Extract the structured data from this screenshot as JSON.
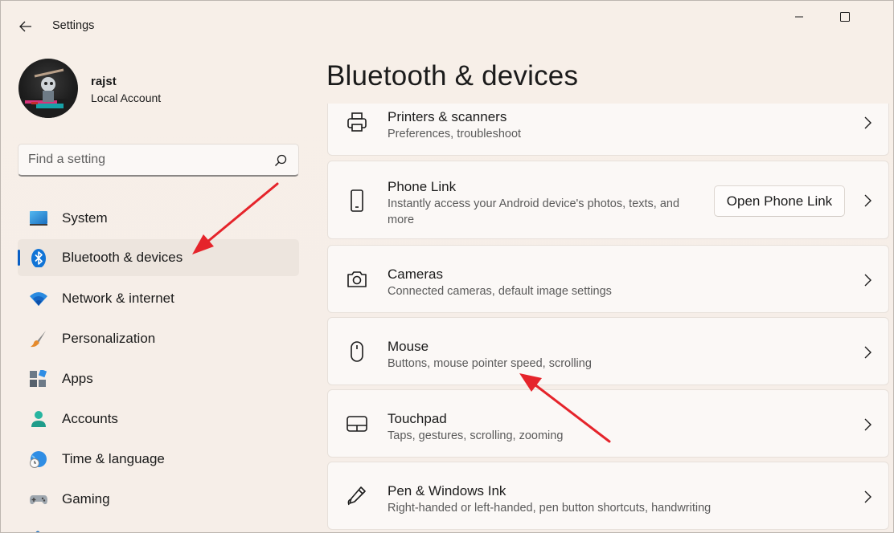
{
  "app": {
    "title": "Settings"
  },
  "profile": {
    "name": "rajst",
    "account_type": "Local Account"
  },
  "search": {
    "placeholder": "Find a setting",
    "value": ""
  },
  "sidebar": {
    "items": [
      {
        "label": "System",
        "icon": "system-icon",
        "selected": false
      },
      {
        "label": "Bluetooth & devices",
        "icon": "bluetooth-icon",
        "selected": true
      },
      {
        "label": "Network & internet",
        "icon": "wifi-icon",
        "selected": false
      },
      {
        "label": "Personalization",
        "icon": "brush-icon",
        "selected": false
      },
      {
        "label": "Apps",
        "icon": "apps-icon",
        "selected": false
      },
      {
        "label": "Accounts",
        "icon": "accounts-icon",
        "selected": false
      },
      {
        "label": "Time & language",
        "icon": "globe-clock-icon",
        "selected": false
      },
      {
        "label": "Gaming",
        "icon": "gamepad-icon",
        "selected": false
      }
    ]
  },
  "main": {
    "page_title": "Bluetooth & devices",
    "cards": [
      {
        "title": "Printers & scanners",
        "description": "Preferences, troubleshoot",
        "icon": "printer-icon"
      },
      {
        "title": "Phone Link",
        "description": "Instantly access your Android device's photos, texts, and more",
        "icon": "phone-icon",
        "button_label": "Open Phone Link"
      },
      {
        "title": "Cameras",
        "description": "Connected cameras, default image settings",
        "icon": "camera-icon"
      },
      {
        "title": "Mouse",
        "description": "Buttons, mouse pointer speed, scrolling",
        "icon": "mouse-icon"
      },
      {
        "title": "Touchpad",
        "description": "Taps, gestures, scrolling, zooming",
        "icon": "touchpad-icon"
      },
      {
        "title": "Pen & Windows Ink",
        "description": "Right-handed or left-handed, pen button shortcuts, handwriting",
        "icon": "pen-icon"
      }
    ]
  },
  "colors": {
    "accent": "#0a5fc4",
    "annotation_arrow": "#e5242b",
    "background": "#f6eee8"
  }
}
